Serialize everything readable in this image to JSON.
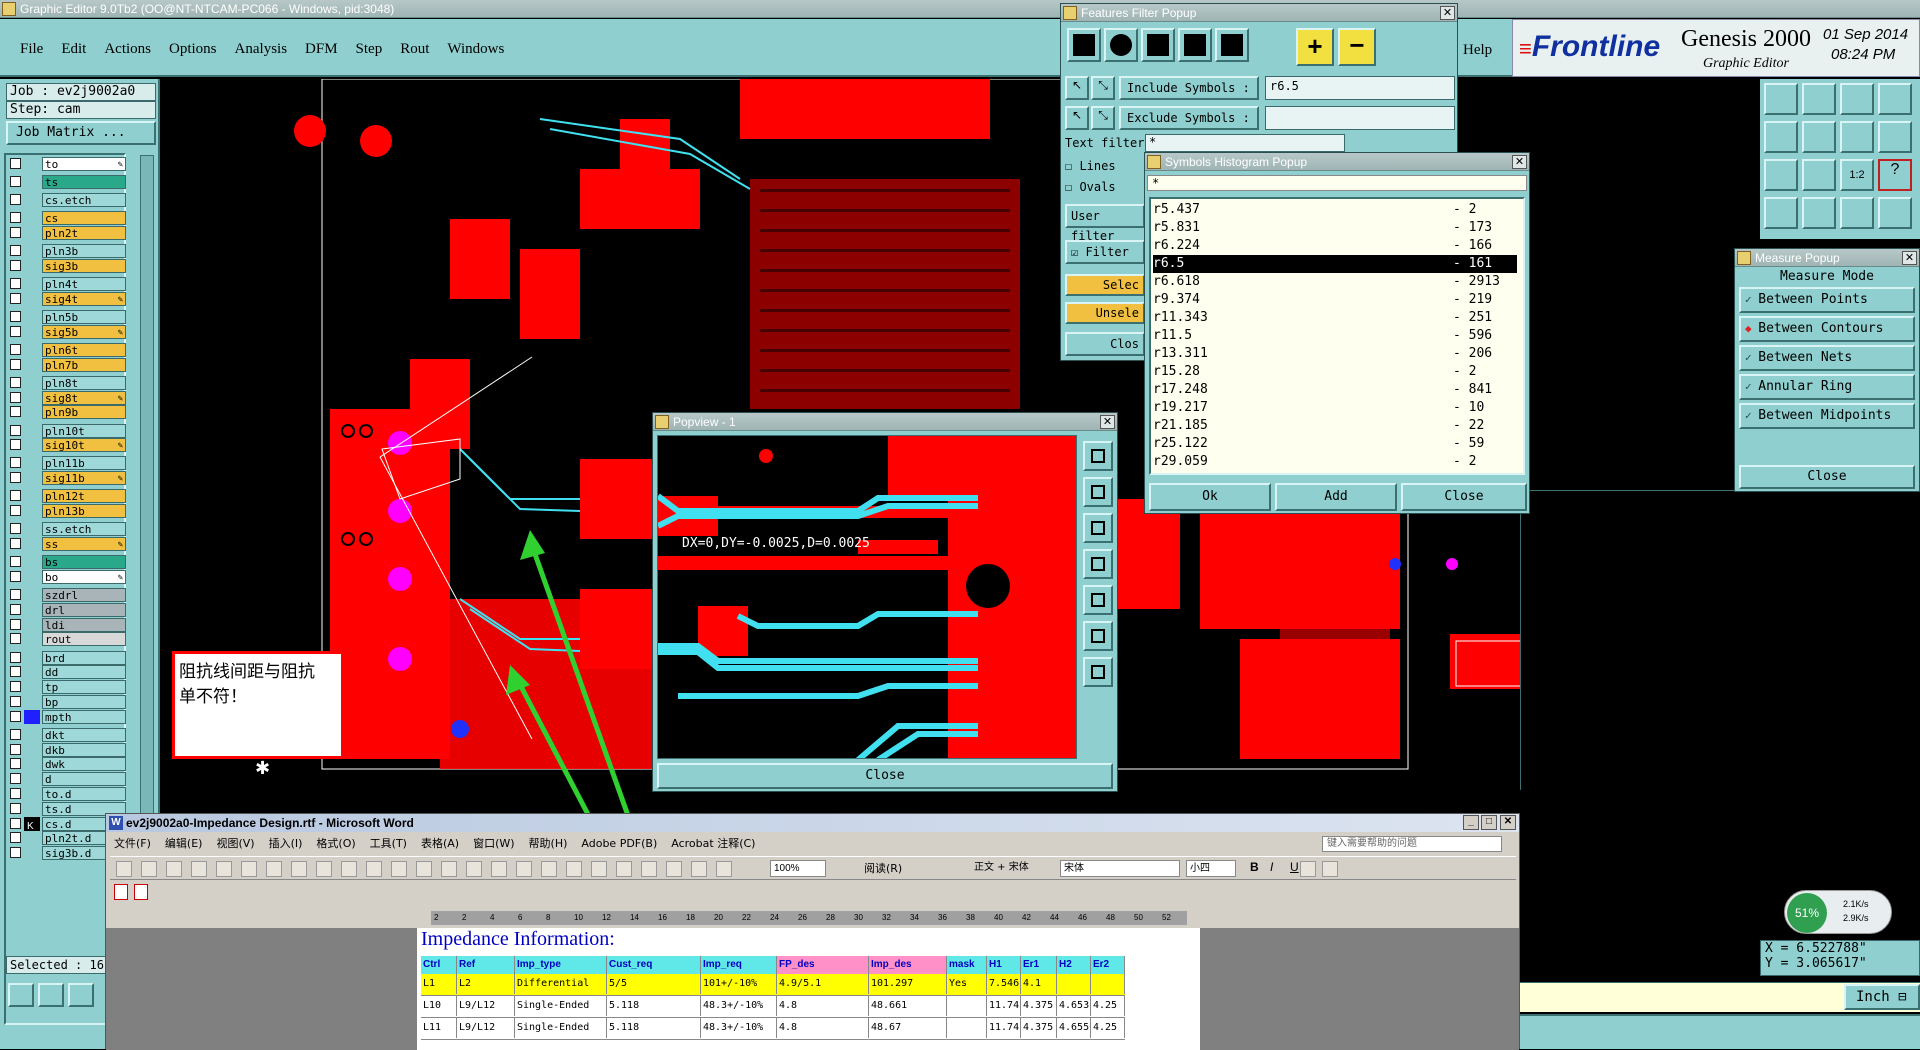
{
  "main_window": {
    "title": "Graphic Editor 9.0Tb2 (OO@NT-NTCAM-PC066 - Windows, pid:3048)"
  },
  "menu": [
    "File",
    "Edit",
    "Actions",
    "Options",
    "Analysis",
    "DFM",
    "Step",
    "Rout",
    "Windows",
    "Help"
  ],
  "brand": {
    "logo": "Frontline",
    "product": "Genesis 2000",
    "subtitle": "Graphic Editor",
    "date": "01 Sep 2014",
    "time": "08:24 PM"
  },
  "job": {
    "job_label": "Job : ev2j9002a0",
    "step_label": "Step: cam",
    "matrix_button": "Job Matrix ...",
    "selected": "Selected : 16"
  },
  "layers": [
    {
      "name": "to",
      "color": "#ffffff",
      "mark": true
    },
    {
      "name": "ts",
      "color": "#2aa88a",
      "mark": false
    },
    {
      "name": "cs.etch",
      "color": "#9fd8d8",
      "mark": false
    },
    {
      "name": "cs",
      "color": "#f2c040",
      "mark": false
    },
    {
      "name": "pln2t",
      "color": "#f2c040",
      "mark": false
    },
    {
      "name": "pln3b",
      "color": "#9fd8d8",
      "mark": false
    },
    {
      "name": "sig3b",
      "color": "#f2c040",
      "mark": false
    },
    {
      "name": "pln4t",
      "color": "#9fd8d8",
      "mark": false
    },
    {
      "name": "sig4t",
      "color": "#f2c040",
      "mark": true
    },
    {
      "name": "pln5b",
      "color": "#9fd8d8",
      "mark": false
    },
    {
      "name": "sig5b",
      "color": "#f2c040",
      "mark": true
    },
    {
      "name": "pln6t",
      "color": "#f2c040",
      "mark": false
    },
    {
      "name": "pln7b",
      "color": "#f2c040",
      "mark": false
    },
    {
      "name": "pln8t",
      "color": "#9fd8d8",
      "mark": false
    },
    {
      "name": "sig8t",
      "color": "#f2c040",
      "mark": true
    },
    {
      "name": "pln9b",
      "color": "#f2c040",
      "mark": false
    },
    {
      "name": "pln10t",
      "color": "#9fd8d8",
      "mark": false
    },
    {
      "name": "sig10t",
      "color": "#f2c040",
      "mark": true
    },
    {
      "name": "pln11b",
      "color": "#9fd8d8",
      "mark": false
    },
    {
      "name": "sig11b",
      "color": "#f2c040",
      "mark": true
    },
    {
      "name": "pln12t",
      "color": "#f2c040",
      "mark": false
    },
    {
      "name": "pln13b",
      "color": "#f2c040",
      "mark": false
    },
    {
      "name": "ss.etch",
      "color": "#9fd8d8",
      "mark": false
    },
    {
      "name": "ss",
      "color": "#f2c040",
      "mark": true
    },
    {
      "name": "bs",
      "color": "#2aa88a",
      "mark": false
    },
    {
      "name": "bo",
      "color": "#ffffff",
      "mark": true
    },
    {
      "name": "szdrl",
      "color": "#a8b4b8",
      "mark": false
    },
    {
      "name": "drl",
      "color": "#a8b4b8",
      "mark": false
    },
    {
      "name": "ldi",
      "color": "#a8b4b8",
      "mark": false
    },
    {
      "name": "rout",
      "color": "#d8d8d8",
      "mark": false
    },
    {
      "name": "brd",
      "color": "#9fd8d8",
      "mark": false
    },
    {
      "name": "dd",
      "color": "#9fd8d8",
      "mark": false
    },
    {
      "name": "tp",
      "color": "#9fd8d8",
      "mark": false
    },
    {
      "name": "bp",
      "color": "#9fd8d8",
      "mark": false
    },
    {
      "name": "mpth",
      "color": "#9fd8d8",
      "mark": false
    },
    {
      "name": "dkt",
      "color": "#9fd8d8",
      "mark": false
    },
    {
      "name": "dkb",
      "color": "#9fd8d8",
      "mark": false
    },
    {
      "name": "dwk",
      "color": "#9fd8d8",
      "mark": false
    },
    {
      "name": "d",
      "color": "#9fd8d8",
      "mark": false
    },
    {
      "name": "to.d",
      "color": "#9fd8d8",
      "mark": false
    },
    {
      "name": "ts.d",
      "color": "#9fd8d8",
      "mark": false
    },
    {
      "name": "cs.d",
      "color": "#9fd8d8",
      "mark": false
    },
    {
      "name": "pln2t.d",
      "color": "#9fd8d8",
      "mark": false
    },
    {
      "name": "sig3b.d",
      "color": "#9fd8d8",
      "mark": false
    }
  ],
  "features_filter": {
    "title": "Features Filter Popup",
    "include_label": "Include Symbols :",
    "include_value": "r6.5",
    "exclude_label": "Exclude Symbols :",
    "exclude_value": "",
    "text_filter_label": "Text filter",
    "text_filter_value": "*",
    "lines": "Lines",
    "ovals": "Ovals",
    "user_filter": "User filter",
    "filter": "Filter",
    "select": "Selec",
    "unselect": "Unsele",
    "close": "Clos"
  },
  "histogram": {
    "title": "Symbols Histogram Popup",
    "filter": "*",
    "rows": [
      {
        "sym": "r5.437",
        "count": "- 2"
      },
      {
        "sym": "r5.831",
        "count": "- 173"
      },
      {
        "sym": "r6.224",
        "count": "- 166"
      },
      {
        "sym": "r6.5",
        "count": "- 161"
      },
      {
        "sym": "r6.618",
        "count": "- 2913"
      },
      {
        "sym": "r9.374",
        "count": "- 219"
      },
      {
        "sym": "r11.343",
        "count": "- 251"
      },
      {
        "sym": "r11.5",
        "count": "- 596"
      },
      {
        "sym": "r13.311",
        "count": "- 206"
      },
      {
        "sym": "r15.28",
        "count": "- 2"
      },
      {
        "sym": "r17.248",
        "count": "- 841"
      },
      {
        "sym": "r19.217",
        "count": "- 10"
      },
      {
        "sym": "r21.185",
        "count": "- 22"
      },
      {
        "sym": "r25.122",
        "count": "- 59"
      },
      {
        "sym": "r29.059",
        "count": "- 2"
      }
    ],
    "selected_index": 3,
    "ok": "Ok",
    "add": "Add",
    "close": "Close"
  },
  "measure": {
    "title": "Measure Popup",
    "mode_label": "Measure Mode",
    "modes": [
      "Between Points",
      "Between Contours",
      "Between Nets",
      "Annular Ring",
      "Between Midpoints"
    ],
    "active_index": 1,
    "close": "Close"
  },
  "popview": {
    "title": "Popview - 1",
    "measure_text": "DX=0,DY=-0.0025,D=0.0025",
    "close": "Close"
  },
  "annotation": {
    "text": "阻抗线间距与阻抗单不符！"
  },
  "coords": {
    "x": "X = 6.522788\"",
    "y": "Y = 3.065617\"",
    "unit": "Inch"
  },
  "net_widget": {
    "percent": "51%",
    "up": "2.1K/s",
    "down": "2.9K/s"
  },
  "word": {
    "title": "ev2j9002a0-Impedance Design.rtf - Microsoft Word",
    "menu": [
      "文件(F)",
      "编辑(E)",
      "视图(V)",
      "插入(I)",
      "格式(O)",
      "工具(T)",
      "表格(A)",
      "窗口(W)",
      "帮助(H)",
      "Adobe PDF(B)",
      "Acrobat 注释(C)"
    ],
    "help_box": "键入需要帮助的问题",
    "zoom": "100%",
    "read_mode": "阅读(R)",
    "style": "正文 + 宋体",
    "font": "宋体",
    "size": "小四",
    "ruler": [
      "2",
      "2",
      "4",
      "6",
      "8",
      "10",
      "12",
      "14",
      "16",
      "18",
      "20",
      "22",
      "24",
      "26",
      "28",
      "30",
      "32",
      "34",
      "36",
      "38",
      "40",
      "42",
      "44",
      "46",
      "48",
      "50",
      "52"
    ],
    "doc_heading": "Impedance Information:",
    "table_headers": [
      "Ctrl",
      "Ref",
      "Imp_type",
      "Cust_req",
      "Imp_req",
      "FP_des",
      "Imp_des",
      "mask",
      "H1",
      "Er1",
      "H2",
      "Er2"
    ],
    "table_rows": [
      [
        "L1",
        "L2",
        "Differential",
        "5/5",
        "101+/-10%",
        "4.9/5.1",
        "101.297",
        "Yes",
        "7.546",
        "4.1",
        "",
        ""
      ],
      [
        "L10",
        "L9/L12",
        "Single-Ended",
        "5.118",
        "48.3+/-10%",
        "4.8",
        "48.661",
        "",
        "11.742",
        "4.375",
        "4.653",
        "4.25"
      ],
      [
        "L11",
        "L9/L12",
        "Single-Ended",
        "5.118",
        "48.3+/-10%",
        "4.8",
        "48.67",
        "",
        "11.74",
        "4.375",
        "4.655",
        "4.25"
      ]
    ]
  },
  "colors": {
    "copper": "#ff0000",
    "trace": "#40e0f0",
    "panel": "#8fcfcf",
    "highlight": "#ffff00",
    "arrow": "#30d030"
  }
}
